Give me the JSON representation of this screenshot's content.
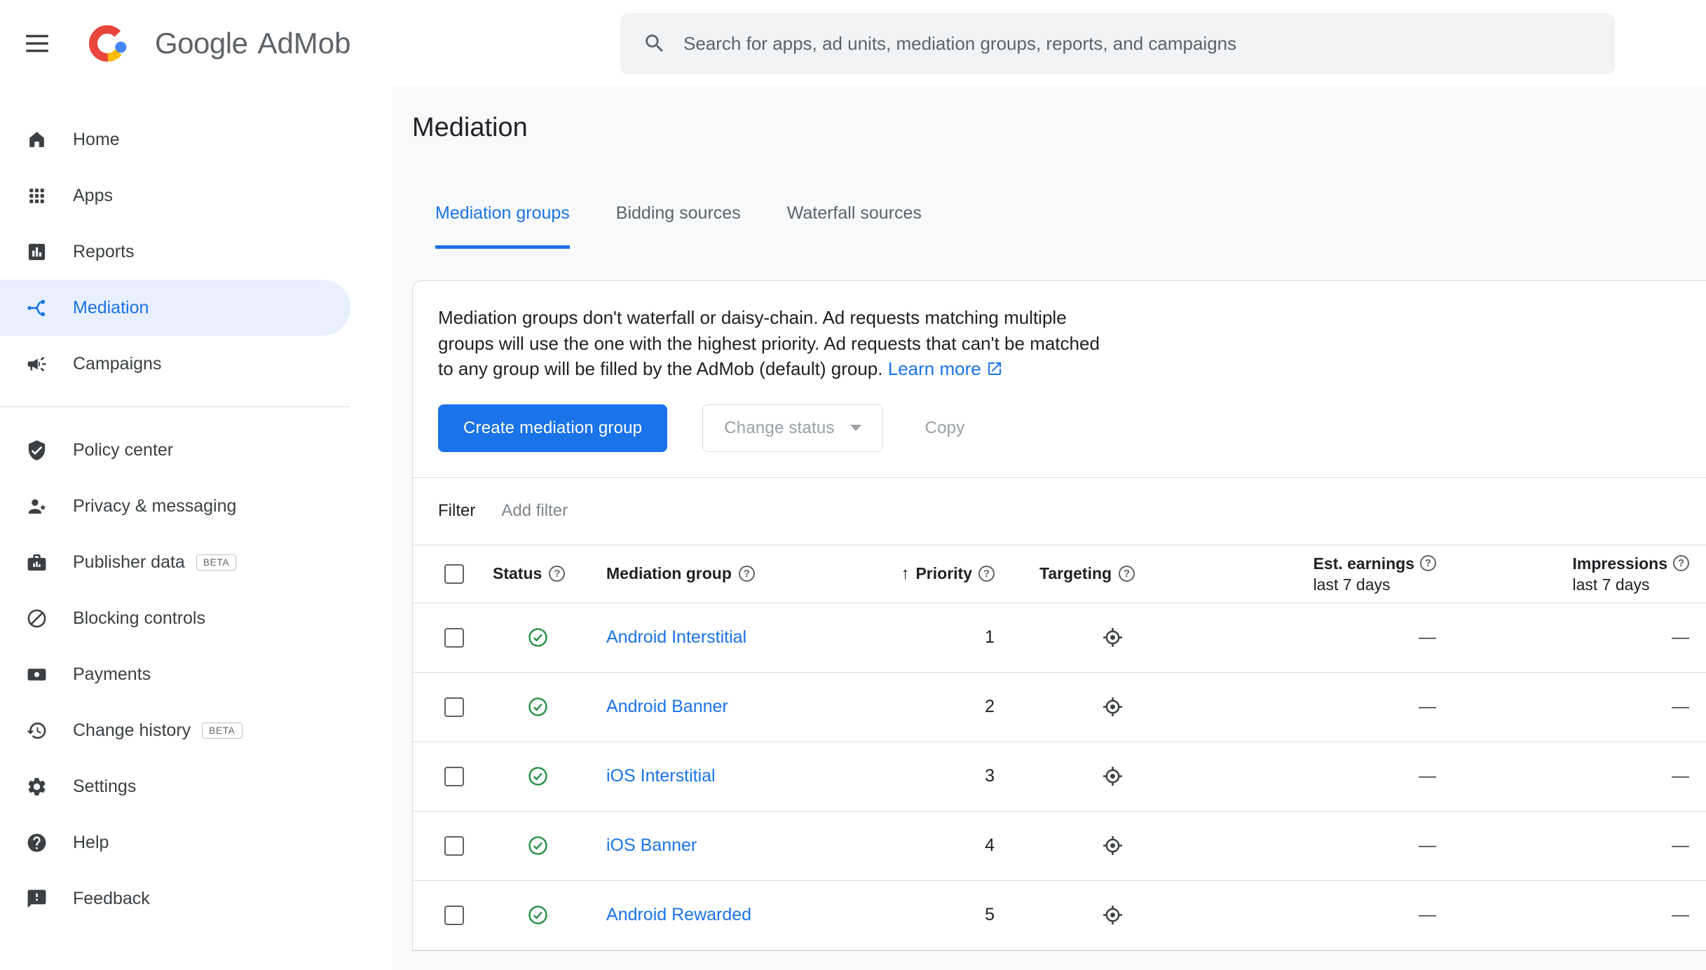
{
  "colors": {
    "accent_blue": "#1a73e8",
    "selected_item_bg": "#e8f0fe",
    "status_green": "#1e8e3e",
    "text_primary": "#202124",
    "text_secondary": "#5f6368",
    "divider": "#e0e0e0",
    "search_bg": "#f1f3f4",
    "main_bg": "#f8f9fa"
  },
  "icons": {
    "menu": "hamburger-icon",
    "logo": "admob-logo-icon",
    "search": "search-icon",
    "help": "question-circle-icon",
    "status_active": "green-check-circle-icon",
    "targeting": "crosshair-target-icon",
    "external_link": "open-in-new-icon",
    "dropdown": "caret-down-icon"
  },
  "header": {
    "brand": "Google",
    "product": "AdMob",
    "search_placeholder": "Search for apps, ad units, mediation groups, reports, and campaigns"
  },
  "sidebar": {
    "primary": [
      {
        "label": "Home"
      },
      {
        "label": "Apps"
      },
      {
        "label": "Reports"
      },
      {
        "label": "Mediation"
      },
      {
        "label": "Campaigns"
      }
    ],
    "secondary": [
      {
        "label": "Policy center"
      },
      {
        "label": "Privacy & messaging"
      },
      {
        "label": "Publisher data",
        "badge": "BETA"
      },
      {
        "label": "Blocking controls"
      },
      {
        "label": "Payments"
      },
      {
        "label": "Change history",
        "badge": "BETA"
      },
      {
        "label": "Settings"
      },
      {
        "label": "Help"
      },
      {
        "label": "Feedback"
      }
    ]
  },
  "page": {
    "title": "Mediation",
    "tabs": [
      {
        "label": "Mediation groups"
      },
      {
        "label": "Bidding sources"
      },
      {
        "label": "Waterfall sources"
      }
    ]
  },
  "card": {
    "description": "Mediation groups don't waterfall or daisy-chain. Ad requests matching multiple groups will use the one with the highest priority. Ad requests that can't be matched to any group will be filled by the AdMob (default) group.",
    "learn_more": "Learn more",
    "actions": {
      "create": "Create mediation group",
      "change_status": "Change status",
      "copy": "Copy"
    },
    "filter": {
      "label": "Filter",
      "add_filter": "Add filter"
    },
    "table": {
      "sort_icon": "↑",
      "columns": {
        "status": "Status",
        "group": "Mediation group",
        "priority": "Priority",
        "targeting": "Targeting",
        "earnings": "Est. earnings",
        "earnings_sub": "last 7 days",
        "impressions": "Impressions",
        "impressions_sub": "last 7 days"
      },
      "rows": [
        {
          "name": "Android Interstitial",
          "priority": "1",
          "earnings": "—",
          "impressions": "—",
          "status": "active"
        },
        {
          "name": "Android Banner",
          "priority": "2",
          "earnings": "—",
          "impressions": "—",
          "status": "active"
        },
        {
          "name": "iOS Interstitial",
          "priority": "3",
          "earnings": "—",
          "impressions": "—",
          "status": "active"
        },
        {
          "name": "iOS Banner",
          "priority": "4",
          "earnings": "—",
          "impressions": "—",
          "status": "active"
        },
        {
          "name": "Android Rewarded",
          "priority": "5",
          "earnings": "—",
          "impressions": "—",
          "status": "active"
        }
      ]
    }
  }
}
